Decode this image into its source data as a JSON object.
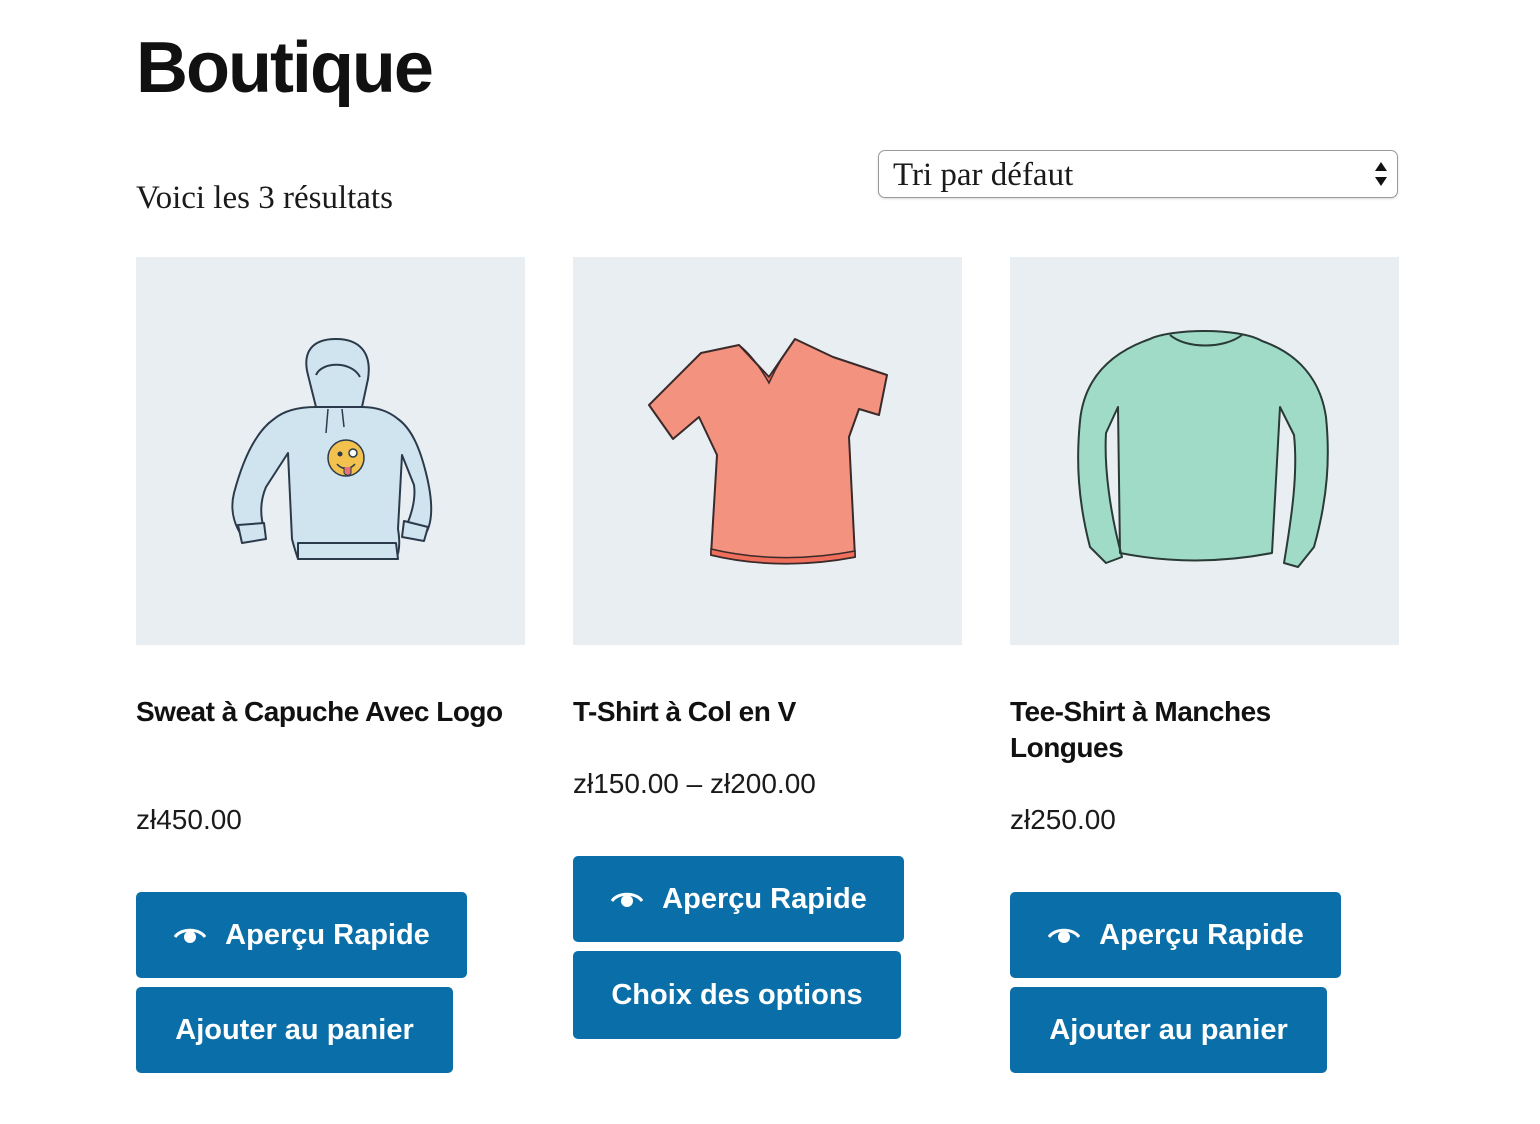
{
  "page": {
    "title": "Boutique"
  },
  "results": {
    "count_text": "Voici les 3 résultats"
  },
  "ordering": {
    "selected": "Tri par défaut"
  },
  "colors": {
    "button": "#0a6fa8",
    "image_background": "#e9eef3"
  },
  "products": [
    {
      "title": "Sweat à Capuche Avec Logo",
      "price": "zł450.00",
      "image_icon": "hoodie-illustration",
      "quick_view_label": "Aperçu Rapide",
      "action_label": "Ajouter au panier"
    },
    {
      "title": "T-Shirt à Col en V",
      "price": "zł150.00 – zł200.00",
      "image_icon": "vneck-tshirt-illustration",
      "quick_view_label": "Aperçu Rapide",
      "action_label": "Choix des options"
    },
    {
      "title": "Tee-Shirt à Manches Longues",
      "price": "zł250.00",
      "image_icon": "long-sleeve-tshirt-illustration",
      "quick_view_label": "Aperçu Rapide",
      "action_label": "Ajouter au panier"
    }
  ]
}
